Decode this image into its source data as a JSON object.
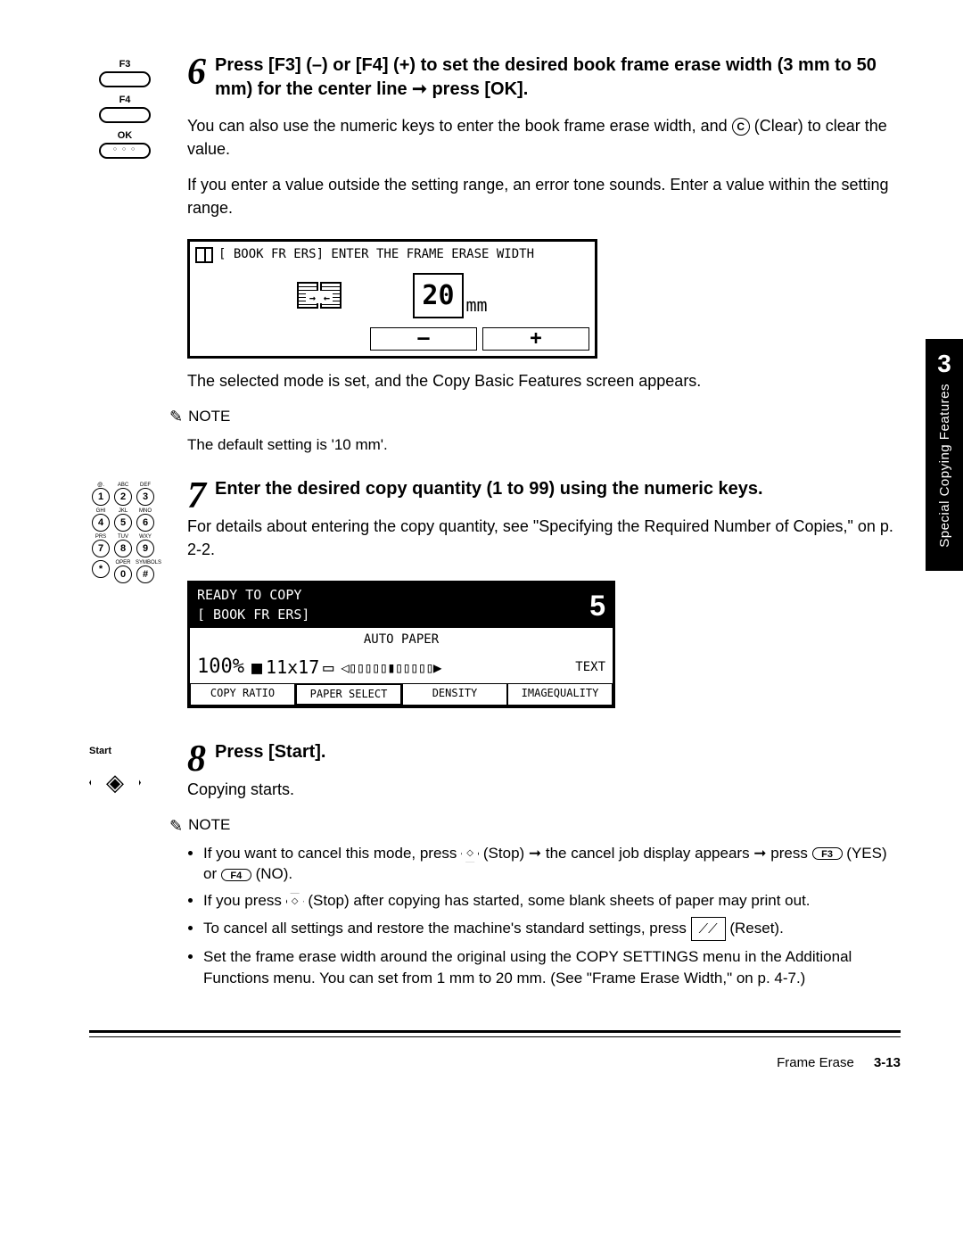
{
  "side_tab": {
    "number": "3",
    "label": "Special Copying Features"
  },
  "step6": {
    "num": "6",
    "icons": {
      "f3": "F3",
      "f4": "F4",
      "ok": "OK"
    },
    "head": "Press [F3] (–) or [F4] (+) to set the desired book frame erase width (3 mm to 50 mm) for the center line ➞ press [OK].",
    "body1a": "You can also use the numeric keys to enter the book frame erase width, and ",
    "body1b": " (Clear) to clear the value.",
    "c_label": "C",
    "body2": "If you enter a value outside the setting range, an error tone sounds. Enter a value within the setting range.",
    "lcd": {
      "header": "[ BOOK FR ERS] ENTER THE FRAME ERASE WIDTH",
      "value": "20",
      "unit": "mm",
      "minus": "–",
      "plus": "+"
    },
    "after_lcd": "The selected mode is set, and the Copy Basic Features screen appears.",
    "note_label": "NOTE",
    "note_text": "The default setting is '10 mm'."
  },
  "step7": {
    "num": "7",
    "head": "Enter the desired copy quantity (1 to 99) using the numeric keys.",
    "body": "For details about entering the copy quantity, see \"Specifying the Required Number of Copies,\" on p. 2-2.",
    "keypad_tiny": [
      "@.",
      "ABC",
      "DEF",
      "GHI",
      "JKL",
      "MNO",
      "PRS",
      "TUV",
      "WXY",
      "",
      "OPER",
      "SYMBOLS"
    ],
    "keypad_keys": [
      "1",
      "2",
      "3",
      "4",
      "5",
      "6",
      "7",
      "8",
      "9",
      "*",
      "0",
      "#"
    ],
    "lcd": {
      "line1": "READY TO COPY",
      "line2": "[ BOOK FR ERS]",
      "big": "5",
      "auto": "AUTO PAPER",
      "pct": "100%",
      "paper": "11x17",
      "text": "TEXT",
      "tabs": [
        "COPY RATIO",
        "PAPER SELECT",
        "DENSITY",
        "IMAGEQUALITY"
      ],
      "sel_tab": 1
    }
  },
  "step8": {
    "num": "8",
    "start_label": "Start",
    "head": "Press [Start].",
    "body": "Copying starts.",
    "note_label": "NOTE",
    "bullets": {
      "b1a": "If you want to cancel this mode, press ",
      "b1b": " (Stop) ➞ the cancel job display appears ➞ press ",
      "b1c": " (YES) or ",
      "b1d": " (NO).",
      "f3": "F3",
      "f4": "F4",
      "b2a": "If you press ",
      "b2b": " (Stop) after copying has started, some blank sheets of paper may print out.",
      "b3a": "To cancel all settings and restore the machine's standard settings, press ",
      "b3b": " (Reset).",
      "reset_glyph": "⟋⟋",
      "b4": "Set the frame erase width around the original using the COPY SETTINGS menu in the Additional Functions menu. You can set from 1 mm to 20 mm. (See \"Frame Erase Width,\" on p. 4-7.)"
    }
  },
  "footer": {
    "section": "Frame Erase",
    "page": "3-13"
  }
}
